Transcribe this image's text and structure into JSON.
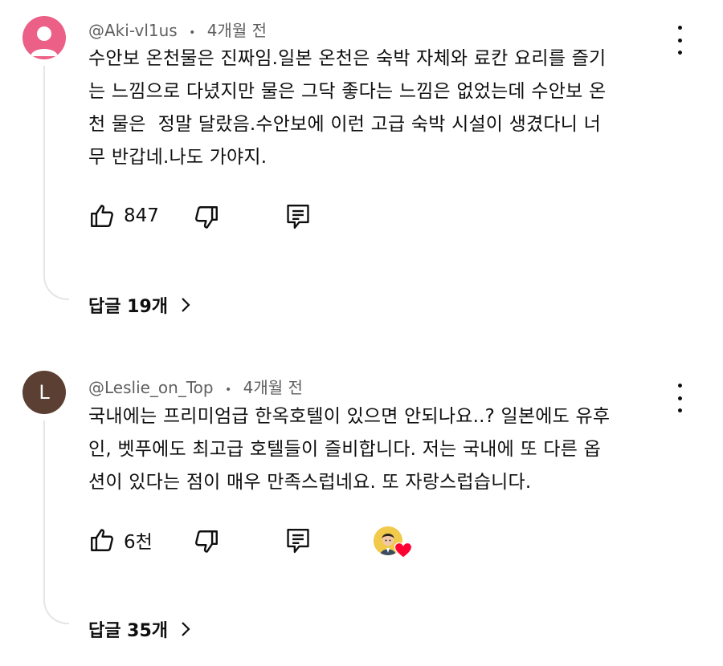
{
  "comments": [
    {
      "handle": "@Aki-vl1us",
      "separator": "•",
      "time": "4개월 전",
      "avatar_letter": "",
      "avatar_color": "#ec5f86",
      "lines": [
        "수안보 온천물은 진짜임.일본 온천은 숙박 자체와 료칸 요리를 즐기",
        "는 느낌으로 다녔지만 물은 그닥 좋다는 느낌은 없었는데 수안보 온",
        "천 물은  정말 달랐음.수안보에 이런 고급 숙박 시설이 생겼다니 너",
        "무 반갑네.나도 가야지."
      ],
      "likes": "847",
      "replies_label": "답글 19개"
    },
    {
      "handle": "@Leslie_on_Top",
      "separator": "•",
      "time": "4개월 전",
      "avatar_letter": "L",
      "avatar_color": "#5b3f33",
      "lines": [
        "국내에는 프리미엄급 한옥호텔이 있으면 안되나요..? 일본에도 유후",
        "인, 벳푸에도 최고급 호텔들이 즐비합니다. 저는 국내에 또 다른 옵",
        "션이 있다는 점이 매우 만족스럽네요. 또 자랑스럽습니다."
      ],
      "likes": "6천",
      "replies_label": "답글 35개"
    }
  ],
  "icons": {
    "like": "thumb-up-icon",
    "dislike": "thumb-down-icon",
    "reply": "comment-reply-icon",
    "more": "more-vertical-icon",
    "replies_chevron": "chevron-right-icon",
    "creator_heart": "heart-icon"
  },
  "colors": {
    "heart": "#ff0033",
    "meta_text": "#606060"
  }
}
